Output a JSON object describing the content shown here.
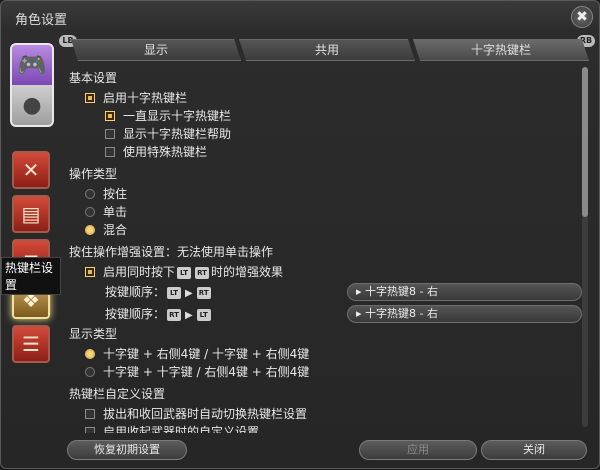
{
  "window": {
    "title": "角色设置"
  },
  "leftbar": {
    "tooltip": "热键栏设置"
  },
  "bumpers": {
    "left": "LB",
    "right": "RB"
  },
  "tabs": [
    "显示",
    "共用",
    "十字热键栏"
  ],
  "sections": {
    "basic": "基本设置",
    "operation": "操作类型",
    "hold_enhance": "按住操作增强设置：无法使用单击操作",
    "display_type": "显示类型",
    "custom": "热键栏自定义设置"
  },
  "basic": {
    "enable": "启用十字热键栏",
    "always_show": "一直显示十字热键栏",
    "show_help": "显示十字热键栏帮助",
    "use_special": "使用特殊热键栏"
  },
  "operation": {
    "hold": "按住",
    "click": "单击",
    "mixed": "混合"
  },
  "hold_enhance": {
    "enable_prefix": "启用同时按下",
    "enable_suffix": "时的增强效果",
    "order_label_1": "按键顺序：",
    "order_label_2": "按键顺序：",
    "dropdown_1": "十字热键8 - 右",
    "dropdown_2": "十字热键8 - 右",
    "kbd_lt": "LT",
    "kbd_rt": "RT"
  },
  "display_type": {
    "option_1": "十字键 + 右侧4键 / 十字键 + 右侧4键",
    "option_2": "十字键 + 十字键 / 右侧4键 + 右侧4键"
  },
  "custom": {
    "weapon_switch": "拔出和收回武器时自动切换热键栏设置",
    "partial": "启用收起武器时的自定义设置"
  },
  "footer": {
    "reset": "恢复初期设置",
    "apply": "应用",
    "close": "关闭"
  },
  "colors": {
    "accent": "#f0b84a",
    "panel": "#262626"
  }
}
